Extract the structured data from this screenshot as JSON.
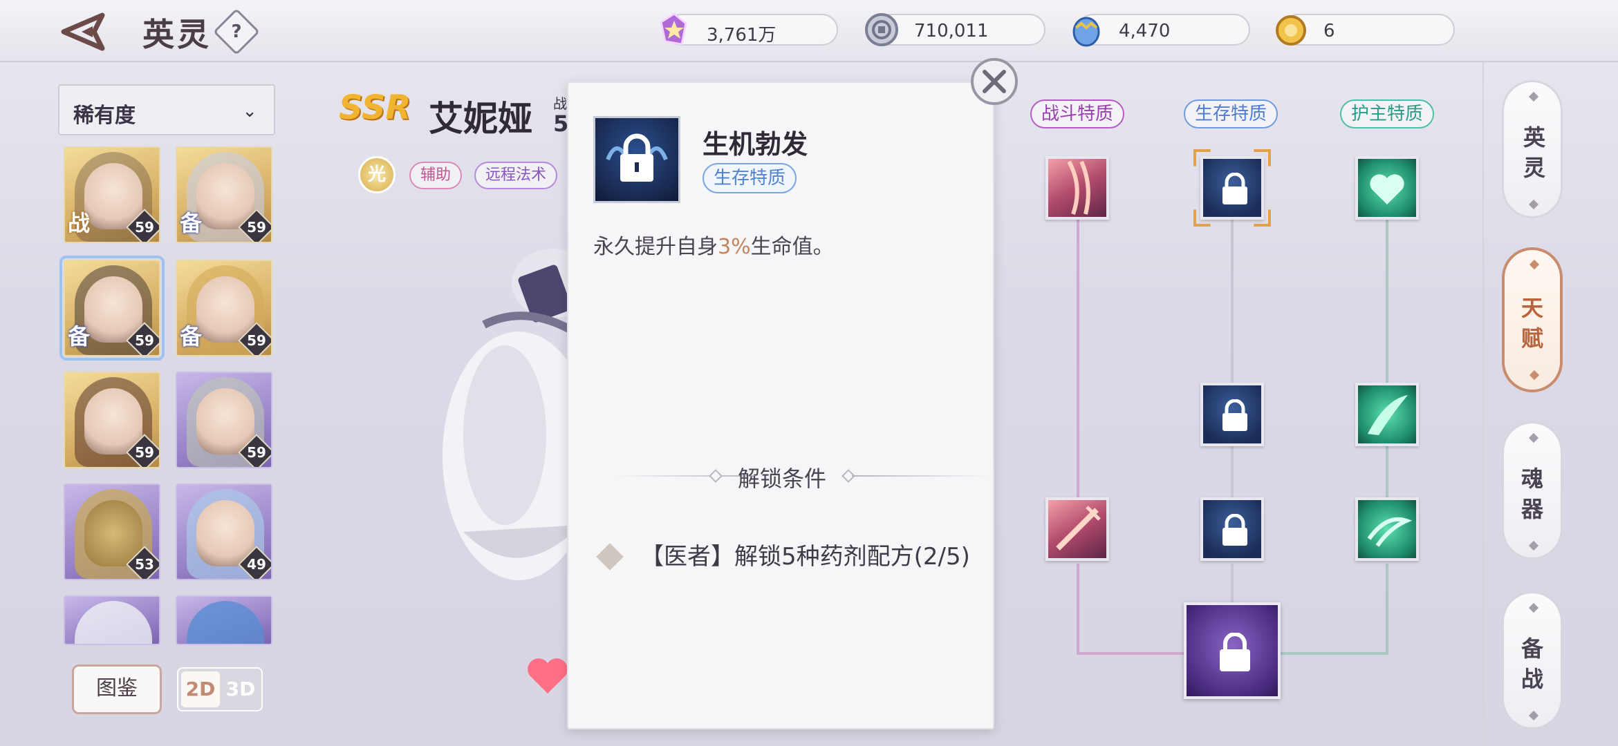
{
  "header": {
    "title": "英灵",
    "help_label": "?",
    "currencies": [
      {
        "icon": "star-crystal-icon",
        "value": "3,761万"
      },
      {
        "icon": "silver-coin-icon",
        "value": "710,011"
      },
      {
        "icon": "blue-egg-icon",
        "value": "4,470"
      },
      {
        "icon": "gold-token-icon",
        "value": "6"
      }
    ]
  },
  "sidebar": {
    "filter_label": "稀有度",
    "heroes": [
      {
        "tag": "战",
        "level": "59",
        "frame": "gold"
      },
      {
        "tag": "备",
        "level": "59",
        "frame": "gold"
      },
      {
        "tag": "备",
        "level": "59",
        "frame": "gold",
        "selected": true
      },
      {
        "tag": "备",
        "level": "59",
        "frame": "gold"
      },
      {
        "tag": "",
        "level": "59",
        "frame": "gold"
      },
      {
        "tag": "",
        "level": "59",
        "frame": "purple"
      },
      {
        "tag": "",
        "level": "53",
        "frame": "purple"
      },
      {
        "tag": "",
        "level": "49",
        "frame": "purple"
      },
      {
        "tag": "",
        "level": "",
        "frame": "purple"
      },
      {
        "tag": "",
        "level": "",
        "frame": "purple"
      }
    ],
    "codex_label": "图鉴",
    "mode_2d": "2D",
    "mode_3d": "3D"
  },
  "hero": {
    "rarity": "SSR",
    "name": "艾妮娅",
    "power_label": "战",
    "power_value": "5",
    "element": "光",
    "roles": [
      "辅助",
      "远程法术"
    ]
  },
  "popup": {
    "skill_name": "生机勃发",
    "skill_type": "生存特质",
    "desc_prefix": "永久提升自身",
    "desc_highlight": "3%",
    "desc_suffix": "生命值。",
    "unlock_title": "解锁条件",
    "requirement": "【医者】解锁5种药剂配方(2/5)"
  },
  "talent_tree": {
    "headers": [
      "战斗特质",
      "生存特质",
      "护主特质"
    ],
    "colors": {
      "fight": "#b45bc4",
      "survival": "#5b86d4",
      "guard": "#3aa89a"
    }
  },
  "right_tabs": [
    {
      "label": "英灵",
      "active": false
    },
    {
      "label": "天赋",
      "active": true
    },
    {
      "label": "魂器",
      "active": false
    },
    {
      "label": "备战",
      "active": false
    }
  ]
}
